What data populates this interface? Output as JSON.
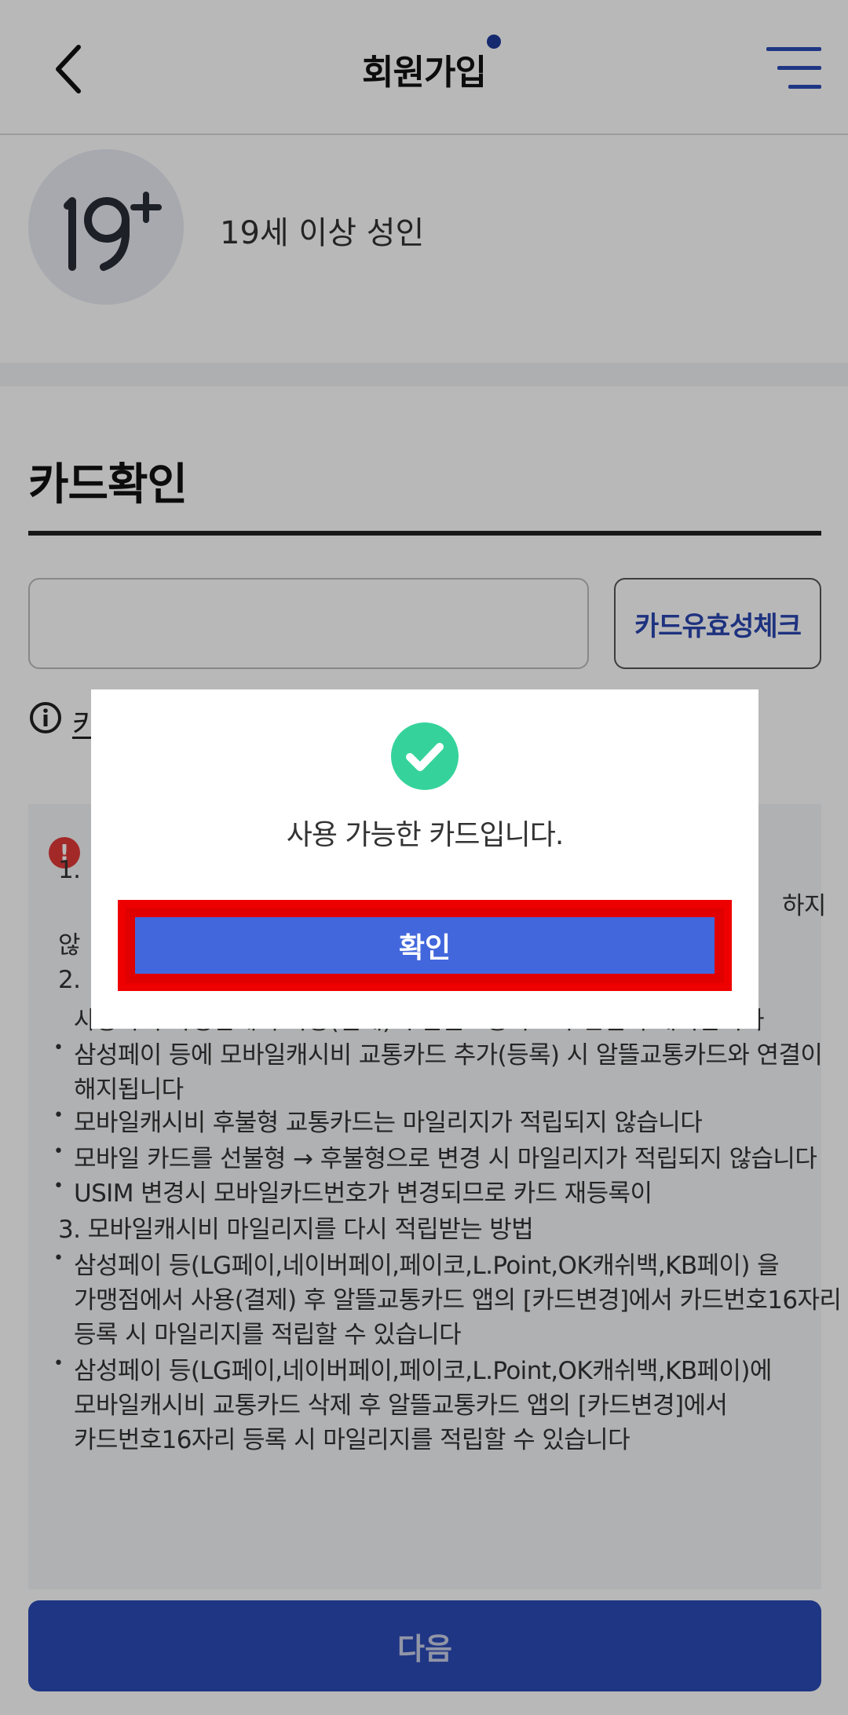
{
  "header": {
    "title": "회원가입",
    "back_icon": "chevron-left-icon",
    "menu_icon": "hamburger-menu-icon"
  },
  "age": {
    "badge_icon": "19-plus-icon",
    "label": "19세 이상 성인"
  },
  "card_check": {
    "title": "카드확인",
    "input_value": "",
    "check_button": "카드유효성체크",
    "info_icon": "info-circle-icon",
    "info_link": "카"
  },
  "notice": {
    "warn_icon": "exclamation-circle-icon",
    "heading": "",
    "lines": [
      {
        "text": "1.",
        "indent": 0,
        "bullet": false
      },
      {
        "text": "하지",
        "indent": 0,
        "bullet": false
      },
      {
        "text": "않",
        "indent": 0,
        "bullet": false
      },
      {
        "text": "2.",
        "indent": 0,
        "bullet": false
      },
      {
        "text": "사용하여 가맹점에서 사용(결제)시 알뜰교통카드와 연결이 해지됩니다",
        "indent": 1,
        "bullet": false
      },
      {
        "text": "삼성페이 등에 모바일캐시비 교통카드 추가(등록) 시 알뜰교통카드와 연결이",
        "indent": 1,
        "bullet": true
      },
      {
        "text": "해지됩니다",
        "indent": 1,
        "bullet": false
      },
      {
        "text": "모바일캐시비 후불형 교통카드는 마일리지가 적립되지 않습니다",
        "indent": 1,
        "bullet": true
      },
      {
        "text": "모바일 카드를 선불형 → 후불형으로 변경 시 마일리지가 적립되지 않습니다",
        "indent": 1,
        "bullet": true
      },
      {
        "text": "USIM 변경시 모바일카드번호가 변경되므로 카드 재등록이",
        "indent": 1,
        "bullet": true
      },
      {
        "text": "3.  모바일캐시비 마일리지를 다시 적립받는 방법",
        "indent": 0,
        "bullet": false
      },
      {
        "text": "삼성페이 등(LG페이,네이버페이,페이코,L.Point,OK캐쉬백,KB페이) 을",
        "indent": 1,
        "bullet": true
      },
      {
        "text": "가맹점에서 사용(결제) 후 알뜰교통카드 앱의 [카드변경]에서 카드번호16자리",
        "indent": 1,
        "bullet": false
      },
      {
        "text": "등록 시 마일리지를 적립할 수 있습니다",
        "indent": 1,
        "bullet": false
      },
      {
        "text": "삼성페이 등(LG페이,네이버페이,페이코,L.Point,OK캐쉬백,KB페이)에",
        "indent": 1,
        "bullet": true
      },
      {
        "text": "모바일캐시비 교통카드 삭제 후 알뜰교통카드 앱의 [카드변경]에서",
        "indent": 1,
        "bullet": false
      },
      {
        "text": "카드번호16자리 등록 시 마일리지를 적립할 수 있습니다",
        "indent": 1,
        "bullet": false
      }
    ]
  },
  "next_button": "다음",
  "dialog": {
    "icon": "check-circle-icon",
    "message": "사용 가능한 카드입니다.",
    "confirm_label": "확인",
    "highlight_color": "#ee0000"
  },
  "colors": {
    "primary": "#2b4bb8",
    "confirm": "#4267dc",
    "success": "#35d39b",
    "warning": "#e23a3a"
  }
}
